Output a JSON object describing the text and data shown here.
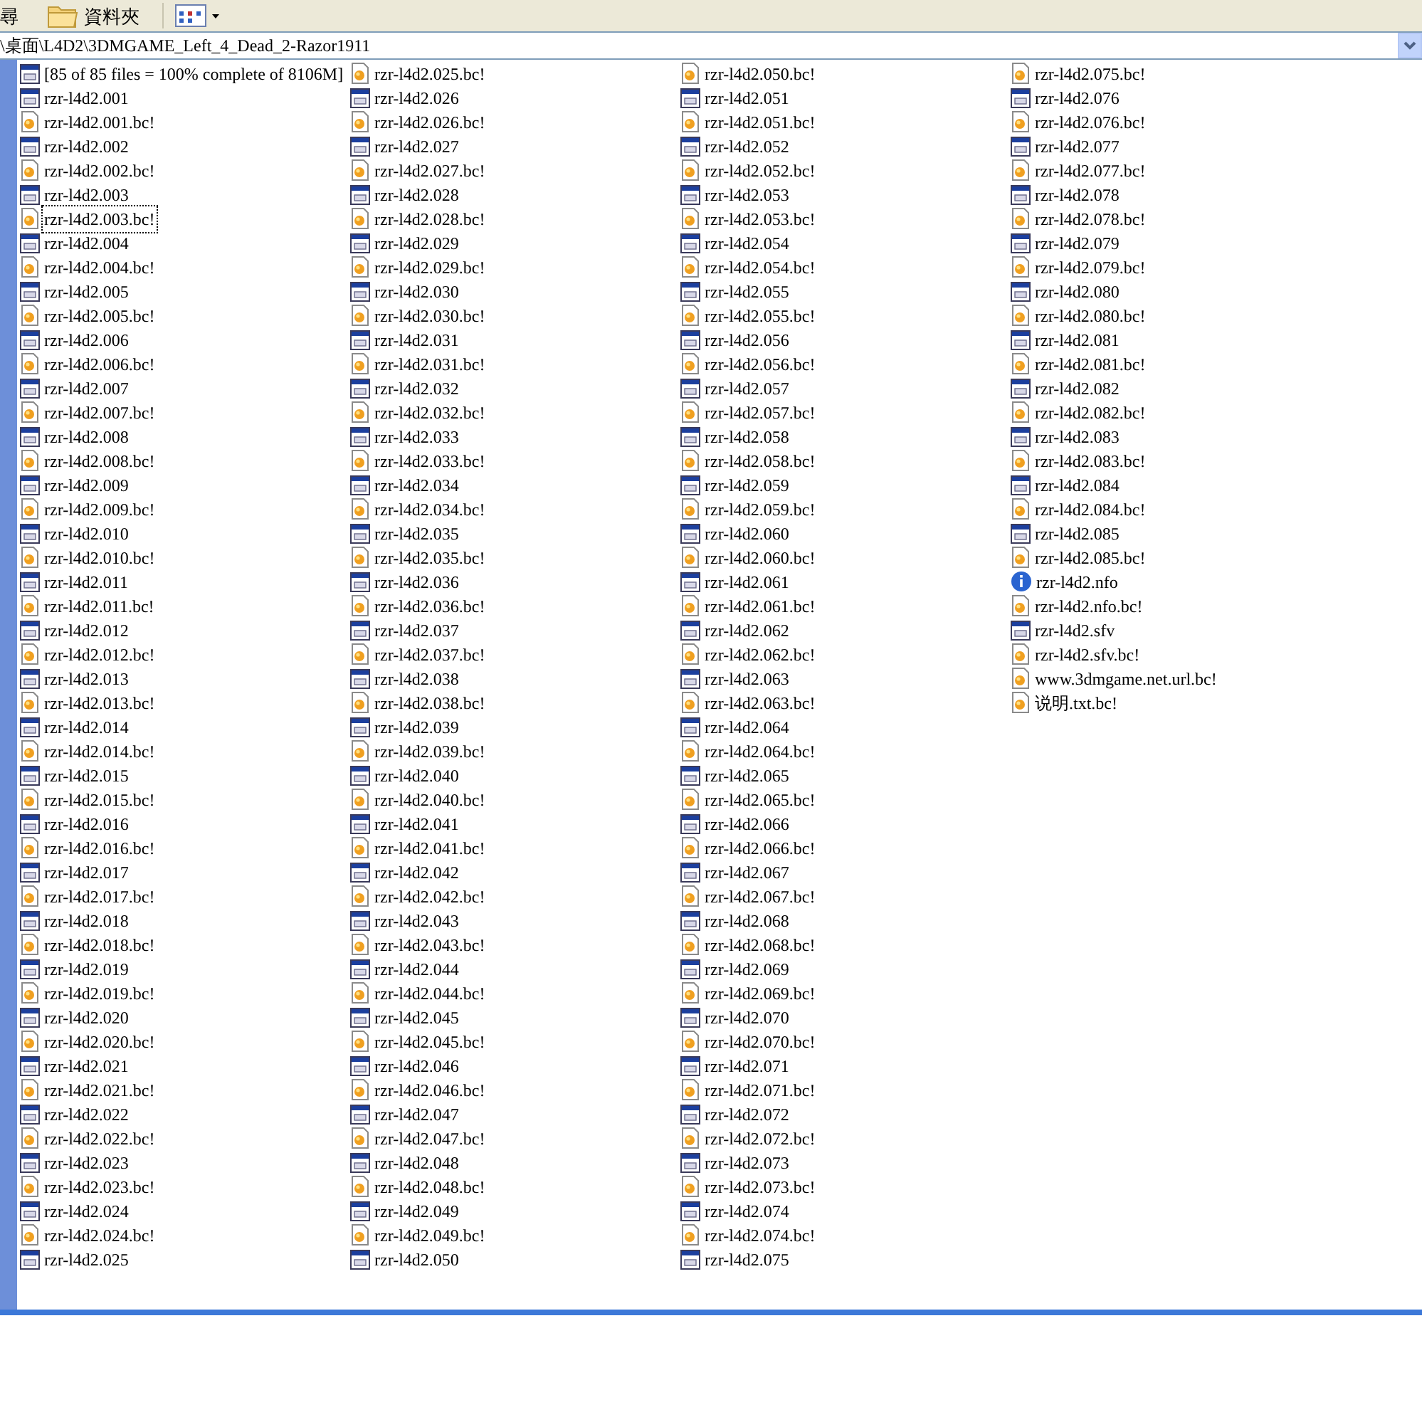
{
  "toolbar": {
    "search_label": "尋",
    "folders_label": "資料夾"
  },
  "address": {
    "path": "\\桌面\\L4D2\\3DMGAME_Left_4_Dead_2-Razor1911"
  },
  "files": [
    {
      "name": "[85 of 85 files = 100% complete of 8106M]",
      "kind": "window",
      "selected": false
    },
    {
      "name": "rzr-l4d2.001",
      "kind": "window",
      "selected": false
    },
    {
      "name": "rzr-l4d2.001.bc!",
      "kind": "partial",
      "selected": false
    },
    {
      "name": "rzr-l4d2.002",
      "kind": "window",
      "selected": false
    },
    {
      "name": "rzr-l4d2.002.bc!",
      "kind": "partial",
      "selected": false
    },
    {
      "name": "rzr-l4d2.003",
      "kind": "window",
      "selected": false
    },
    {
      "name": "rzr-l4d2.003.bc!",
      "kind": "partial",
      "selected": true
    },
    {
      "name": "rzr-l4d2.004",
      "kind": "window",
      "selected": false
    },
    {
      "name": "rzr-l4d2.004.bc!",
      "kind": "partial",
      "selected": false
    },
    {
      "name": "rzr-l4d2.005",
      "kind": "window",
      "selected": false
    },
    {
      "name": "rzr-l4d2.005.bc!",
      "kind": "partial",
      "selected": false
    },
    {
      "name": "rzr-l4d2.006",
      "kind": "window",
      "selected": false
    },
    {
      "name": "rzr-l4d2.006.bc!",
      "kind": "partial",
      "selected": false
    },
    {
      "name": "rzr-l4d2.007",
      "kind": "window",
      "selected": false
    },
    {
      "name": "rzr-l4d2.007.bc!",
      "kind": "partial",
      "selected": false
    },
    {
      "name": "rzr-l4d2.008",
      "kind": "window",
      "selected": false
    },
    {
      "name": "rzr-l4d2.008.bc!",
      "kind": "partial",
      "selected": false
    },
    {
      "name": "rzr-l4d2.009",
      "kind": "window",
      "selected": false
    },
    {
      "name": "rzr-l4d2.009.bc!",
      "kind": "partial",
      "selected": false
    },
    {
      "name": "rzr-l4d2.010",
      "kind": "window",
      "selected": false
    },
    {
      "name": "rzr-l4d2.010.bc!",
      "kind": "partial",
      "selected": false
    },
    {
      "name": "rzr-l4d2.011",
      "kind": "window",
      "selected": false
    },
    {
      "name": "rzr-l4d2.011.bc!",
      "kind": "partial",
      "selected": false
    },
    {
      "name": "rzr-l4d2.012",
      "kind": "window",
      "selected": false
    },
    {
      "name": "rzr-l4d2.012.bc!",
      "kind": "partial",
      "selected": false
    },
    {
      "name": "rzr-l4d2.013",
      "kind": "window",
      "selected": false
    },
    {
      "name": "rzr-l4d2.013.bc!",
      "kind": "partial",
      "selected": false
    },
    {
      "name": "rzr-l4d2.014",
      "kind": "window",
      "selected": false
    },
    {
      "name": "rzr-l4d2.014.bc!",
      "kind": "partial",
      "selected": false
    },
    {
      "name": "rzr-l4d2.015",
      "kind": "window",
      "selected": false
    },
    {
      "name": "rzr-l4d2.015.bc!",
      "kind": "partial",
      "selected": false
    },
    {
      "name": "rzr-l4d2.016",
      "kind": "window",
      "selected": false
    },
    {
      "name": "rzr-l4d2.016.bc!",
      "kind": "partial",
      "selected": false
    },
    {
      "name": "rzr-l4d2.017",
      "kind": "window",
      "selected": false
    },
    {
      "name": "rzr-l4d2.017.bc!",
      "kind": "partial",
      "selected": false
    },
    {
      "name": "rzr-l4d2.018",
      "kind": "window",
      "selected": false
    },
    {
      "name": "rzr-l4d2.018.bc!",
      "kind": "partial",
      "selected": false
    },
    {
      "name": "rzr-l4d2.019",
      "kind": "window",
      "selected": false
    },
    {
      "name": "rzr-l4d2.019.bc!",
      "kind": "partial",
      "selected": false
    },
    {
      "name": "rzr-l4d2.020",
      "kind": "window",
      "selected": false
    },
    {
      "name": "rzr-l4d2.020.bc!",
      "kind": "partial",
      "selected": false
    },
    {
      "name": "rzr-l4d2.021",
      "kind": "window",
      "selected": false
    },
    {
      "name": "rzr-l4d2.021.bc!",
      "kind": "partial",
      "selected": false
    },
    {
      "name": "rzr-l4d2.022",
      "kind": "window",
      "selected": false
    },
    {
      "name": "rzr-l4d2.022.bc!",
      "kind": "partial",
      "selected": false
    },
    {
      "name": "rzr-l4d2.023",
      "kind": "window",
      "selected": false
    },
    {
      "name": "rzr-l4d2.023.bc!",
      "kind": "partial",
      "selected": false
    },
    {
      "name": "rzr-l4d2.024",
      "kind": "window",
      "selected": false
    },
    {
      "name": "rzr-l4d2.024.bc!",
      "kind": "partial",
      "selected": false
    },
    {
      "name": "rzr-l4d2.025",
      "kind": "window",
      "selected": false
    },
    {
      "name": "rzr-l4d2.025.bc!",
      "kind": "partial",
      "selected": false
    },
    {
      "name": "rzr-l4d2.026",
      "kind": "window",
      "selected": false
    },
    {
      "name": "rzr-l4d2.026.bc!",
      "kind": "partial",
      "selected": false
    },
    {
      "name": "rzr-l4d2.027",
      "kind": "window",
      "selected": false
    },
    {
      "name": "rzr-l4d2.027.bc!",
      "kind": "partial",
      "selected": false
    },
    {
      "name": "rzr-l4d2.028",
      "kind": "window",
      "selected": false
    },
    {
      "name": "rzr-l4d2.028.bc!",
      "kind": "partial",
      "selected": false
    },
    {
      "name": "rzr-l4d2.029",
      "kind": "window",
      "selected": false
    },
    {
      "name": "rzr-l4d2.029.bc!",
      "kind": "partial",
      "selected": false
    },
    {
      "name": "rzr-l4d2.030",
      "kind": "window",
      "selected": false
    },
    {
      "name": "rzr-l4d2.030.bc!",
      "kind": "partial",
      "selected": false
    },
    {
      "name": "rzr-l4d2.031",
      "kind": "window",
      "selected": false
    },
    {
      "name": "rzr-l4d2.031.bc!",
      "kind": "partial",
      "selected": false
    },
    {
      "name": "rzr-l4d2.032",
      "kind": "window",
      "selected": false
    },
    {
      "name": "rzr-l4d2.032.bc!",
      "kind": "partial",
      "selected": false
    },
    {
      "name": "rzr-l4d2.033",
      "kind": "window",
      "selected": false
    },
    {
      "name": "rzr-l4d2.033.bc!",
      "kind": "partial",
      "selected": false
    },
    {
      "name": "rzr-l4d2.034",
      "kind": "window",
      "selected": false
    },
    {
      "name": "rzr-l4d2.034.bc!",
      "kind": "partial",
      "selected": false
    },
    {
      "name": "rzr-l4d2.035",
      "kind": "window",
      "selected": false
    },
    {
      "name": "rzr-l4d2.035.bc!",
      "kind": "partial",
      "selected": false
    },
    {
      "name": "rzr-l4d2.036",
      "kind": "window",
      "selected": false
    },
    {
      "name": "rzr-l4d2.036.bc!",
      "kind": "partial",
      "selected": false
    },
    {
      "name": "rzr-l4d2.037",
      "kind": "window",
      "selected": false
    },
    {
      "name": "rzr-l4d2.037.bc!",
      "kind": "partial",
      "selected": false
    },
    {
      "name": "rzr-l4d2.038",
      "kind": "window",
      "selected": false
    },
    {
      "name": "rzr-l4d2.038.bc!",
      "kind": "partial",
      "selected": false
    },
    {
      "name": "rzr-l4d2.039",
      "kind": "window",
      "selected": false
    },
    {
      "name": "rzr-l4d2.039.bc!",
      "kind": "partial",
      "selected": false
    },
    {
      "name": "rzr-l4d2.040",
      "kind": "window",
      "selected": false
    },
    {
      "name": "rzr-l4d2.040.bc!",
      "kind": "partial",
      "selected": false
    },
    {
      "name": "rzr-l4d2.041",
      "kind": "window",
      "selected": false
    },
    {
      "name": "rzr-l4d2.041.bc!",
      "kind": "partial",
      "selected": false
    },
    {
      "name": "rzr-l4d2.042",
      "kind": "window",
      "selected": false
    },
    {
      "name": "rzr-l4d2.042.bc!",
      "kind": "partial",
      "selected": false
    },
    {
      "name": "rzr-l4d2.043",
      "kind": "window",
      "selected": false
    },
    {
      "name": "rzr-l4d2.043.bc!",
      "kind": "partial",
      "selected": false
    },
    {
      "name": "rzr-l4d2.044",
      "kind": "window",
      "selected": false
    },
    {
      "name": "rzr-l4d2.044.bc!",
      "kind": "partial",
      "selected": false
    },
    {
      "name": "rzr-l4d2.045",
      "kind": "window",
      "selected": false
    },
    {
      "name": "rzr-l4d2.045.bc!",
      "kind": "partial",
      "selected": false
    },
    {
      "name": "rzr-l4d2.046",
      "kind": "window",
      "selected": false
    },
    {
      "name": "rzr-l4d2.046.bc!",
      "kind": "partial",
      "selected": false
    },
    {
      "name": "rzr-l4d2.047",
      "kind": "window",
      "selected": false
    },
    {
      "name": "rzr-l4d2.047.bc!",
      "kind": "partial",
      "selected": false
    },
    {
      "name": "rzr-l4d2.048",
      "kind": "window",
      "selected": false
    },
    {
      "name": "rzr-l4d2.048.bc!",
      "kind": "partial",
      "selected": false
    },
    {
      "name": "rzr-l4d2.049",
      "kind": "window",
      "selected": false
    },
    {
      "name": "rzr-l4d2.049.bc!",
      "kind": "partial",
      "selected": false
    },
    {
      "name": "rzr-l4d2.050",
      "kind": "window",
      "selected": false
    },
    {
      "name": "rzr-l4d2.050.bc!",
      "kind": "partial",
      "selected": false
    },
    {
      "name": "rzr-l4d2.051",
      "kind": "window",
      "selected": false
    },
    {
      "name": "rzr-l4d2.051.bc!",
      "kind": "partial",
      "selected": false
    },
    {
      "name": "rzr-l4d2.052",
      "kind": "window",
      "selected": false
    },
    {
      "name": "rzr-l4d2.052.bc!",
      "kind": "partial",
      "selected": false
    },
    {
      "name": "rzr-l4d2.053",
      "kind": "window",
      "selected": false
    },
    {
      "name": "rzr-l4d2.053.bc!",
      "kind": "partial",
      "selected": false
    },
    {
      "name": "rzr-l4d2.054",
      "kind": "window",
      "selected": false
    },
    {
      "name": "rzr-l4d2.054.bc!",
      "kind": "partial",
      "selected": false
    },
    {
      "name": "rzr-l4d2.055",
      "kind": "window",
      "selected": false
    },
    {
      "name": "rzr-l4d2.055.bc!",
      "kind": "partial",
      "selected": false
    },
    {
      "name": "rzr-l4d2.056",
      "kind": "window",
      "selected": false
    },
    {
      "name": "rzr-l4d2.056.bc!",
      "kind": "partial",
      "selected": false
    },
    {
      "name": "rzr-l4d2.057",
      "kind": "window",
      "selected": false
    },
    {
      "name": "rzr-l4d2.057.bc!",
      "kind": "partial",
      "selected": false
    },
    {
      "name": "rzr-l4d2.058",
      "kind": "window",
      "selected": false
    },
    {
      "name": "rzr-l4d2.058.bc!",
      "kind": "partial",
      "selected": false
    },
    {
      "name": "rzr-l4d2.059",
      "kind": "window",
      "selected": false
    },
    {
      "name": "rzr-l4d2.059.bc!",
      "kind": "partial",
      "selected": false
    },
    {
      "name": "rzr-l4d2.060",
      "kind": "window",
      "selected": false
    },
    {
      "name": "rzr-l4d2.060.bc!",
      "kind": "partial",
      "selected": false
    },
    {
      "name": "rzr-l4d2.061",
      "kind": "window",
      "selected": false
    },
    {
      "name": "rzr-l4d2.061.bc!",
      "kind": "partial",
      "selected": false
    },
    {
      "name": "rzr-l4d2.062",
      "kind": "window",
      "selected": false
    },
    {
      "name": "rzr-l4d2.062.bc!",
      "kind": "partial",
      "selected": false
    },
    {
      "name": "rzr-l4d2.063",
      "kind": "window",
      "selected": false
    },
    {
      "name": "rzr-l4d2.063.bc!",
      "kind": "partial",
      "selected": false
    },
    {
      "name": "rzr-l4d2.064",
      "kind": "window",
      "selected": false
    },
    {
      "name": "rzr-l4d2.064.bc!",
      "kind": "partial",
      "selected": false
    },
    {
      "name": "rzr-l4d2.065",
      "kind": "window",
      "selected": false
    },
    {
      "name": "rzr-l4d2.065.bc!",
      "kind": "partial",
      "selected": false
    },
    {
      "name": "rzr-l4d2.066",
      "kind": "window",
      "selected": false
    },
    {
      "name": "rzr-l4d2.066.bc!",
      "kind": "partial",
      "selected": false
    },
    {
      "name": "rzr-l4d2.067",
      "kind": "window",
      "selected": false
    },
    {
      "name": "rzr-l4d2.067.bc!",
      "kind": "partial",
      "selected": false
    },
    {
      "name": "rzr-l4d2.068",
      "kind": "window",
      "selected": false
    },
    {
      "name": "rzr-l4d2.068.bc!",
      "kind": "partial",
      "selected": false
    },
    {
      "name": "rzr-l4d2.069",
      "kind": "window",
      "selected": false
    },
    {
      "name": "rzr-l4d2.069.bc!",
      "kind": "partial",
      "selected": false
    },
    {
      "name": "rzr-l4d2.070",
      "kind": "window",
      "selected": false
    },
    {
      "name": "rzr-l4d2.070.bc!",
      "kind": "partial",
      "selected": false
    },
    {
      "name": "rzr-l4d2.071",
      "kind": "window",
      "selected": false
    },
    {
      "name": "rzr-l4d2.071.bc!",
      "kind": "partial",
      "selected": false
    },
    {
      "name": "rzr-l4d2.072",
      "kind": "window",
      "selected": false
    },
    {
      "name": "rzr-l4d2.072.bc!",
      "kind": "partial",
      "selected": false
    },
    {
      "name": "rzr-l4d2.073",
      "kind": "window",
      "selected": false
    },
    {
      "name": "rzr-l4d2.073.bc!",
      "kind": "partial",
      "selected": false
    },
    {
      "name": "rzr-l4d2.074",
      "kind": "window",
      "selected": false
    },
    {
      "name": "rzr-l4d2.074.bc!",
      "kind": "partial",
      "selected": false
    },
    {
      "name": "rzr-l4d2.075",
      "kind": "window",
      "selected": false
    },
    {
      "name": "rzr-l4d2.075.bc!",
      "kind": "partial",
      "selected": false
    },
    {
      "name": "rzr-l4d2.076",
      "kind": "window",
      "selected": false
    },
    {
      "name": "rzr-l4d2.076.bc!",
      "kind": "partial",
      "selected": false
    },
    {
      "name": "rzr-l4d2.077",
      "kind": "window",
      "selected": false
    },
    {
      "name": "rzr-l4d2.077.bc!",
      "kind": "partial",
      "selected": false
    },
    {
      "name": "rzr-l4d2.078",
      "kind": "window",
      "selected": false
    },
    {
      "name": "rzr-l4d2.078.bc!",
      "kind": "partial",
      "selected": false
    },
    {
      "name": "rzr-l4d2.079",
      "kind": "window",
      "selected": false
    },
    {
      "name": "rzr-l4d2.079.bc!",
      "kind": "partial",
      "selected": false
    },
    {
      "name": "rzr-l4d2.080",
      "kind": "window",
      "selected": false
    },
    {
      "name": "rzr-l4d2.080.bc!",
      "kind": "partial",
      "selected": false
    },
    {
      "name": "rzr-l4d2.081",
      "kind": "window",
      "selected": false
    },
    {
      "name": "rzr-l4d2.081.bc!",
      "kind": "partial",
      "selected": false
    },
    {
      "name": "rzr-l4d2.082",
      "kind": "window",
      "selected": false
    },
    {
      "name": "rzr-l4d2.082.bc!",
      "kind": "partial",
      "selected": false
    },
    {
      "name": "rzr-l4d2.083",
      "kind": "window",
      "selected": false
    },
    {
      "name": "rzr-l4d2.083.bc!",
      "kind": "partial",
      "selected": false
    },
    {
      "name": "rzr-l4d2.084",
      "kind": "window",
      "selected": false
    },
    {
      "name": "rzr-l4d2.084.bc!",
      "kind": "partial",
      "selected": false
    },
    {
      "name": "rzr-l4d2.085",
      "kind": "window",
      "selected": false
    },
    {
      "name": "rzr-l4d2.085.bc!",
      "kind": "partial",
      "selected": false
    },
    {
      "name": "rzr-l4d2.nfo",
      "kind": "info",
      "selected": false
    },
    {
      "name": "rzr-l4d2.nfo.bc!",
      "kind": "partial",
      "selected": false
    },
    {
      "name": "rzr-l4d2.sfv",
      "kind": "window",
      "selected": false
    },
    {
      "name": "rzr-l4d2.sfv.bc!",
      "kind": "partial",
      "selected": false
    },
    {
      "name": "www.3dmgame.net.url.bc!",
      "kind": "partial",
      "selected": false
    },
    {
      "name": "说明.txt.bc!",
      "kind": "partial",
      "selected": false
    }
  ]
}
